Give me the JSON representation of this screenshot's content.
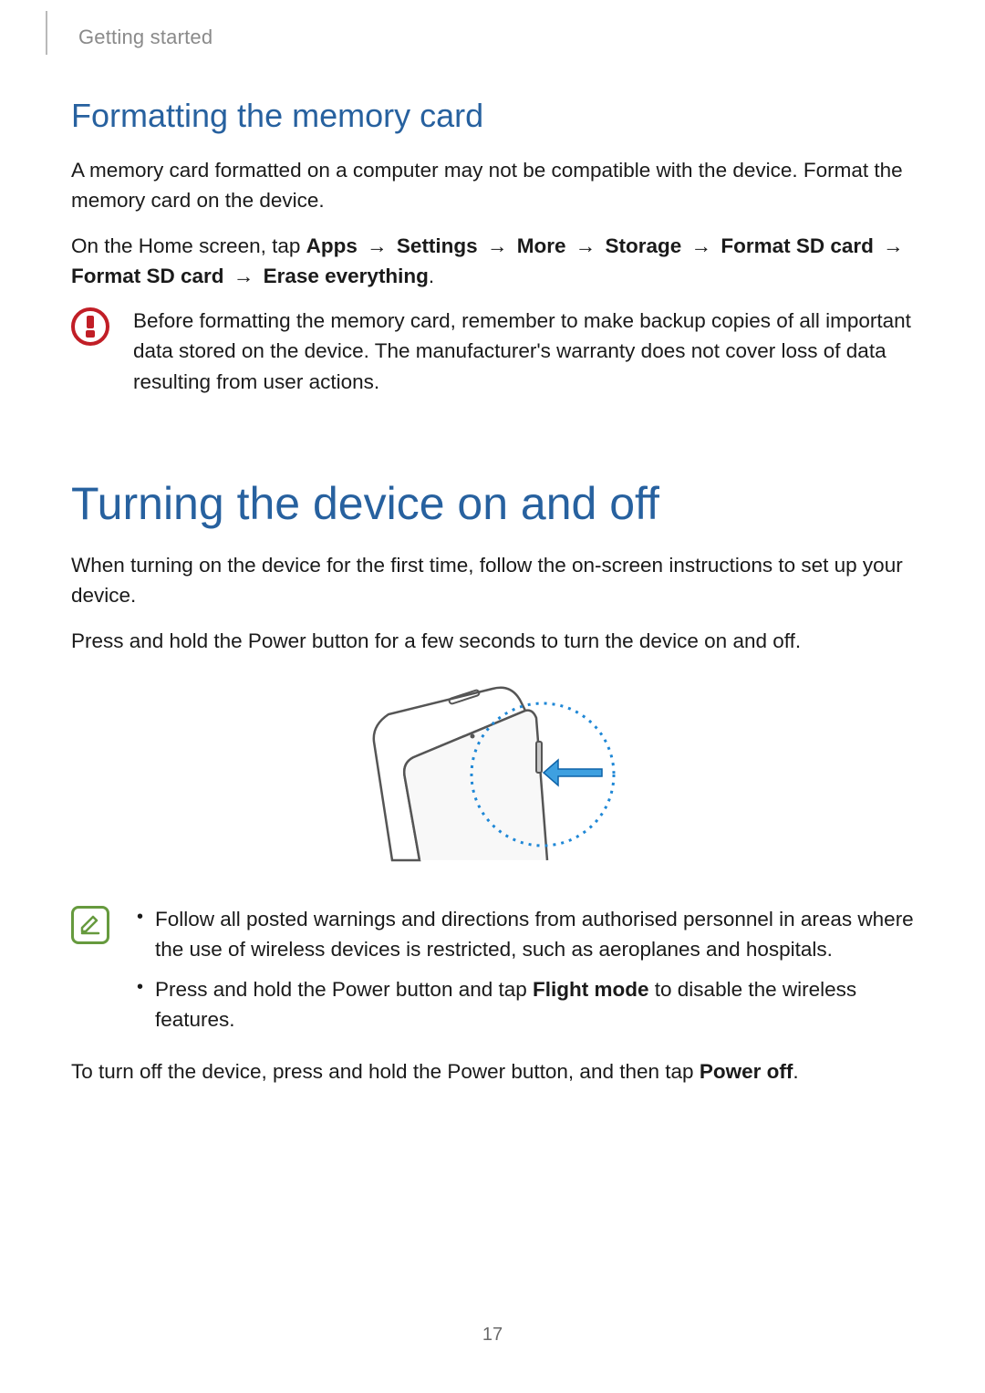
{
  "header": {
    "section": "Getting started"
  },
  "section1": {
    "heading": "Formatting the memory card",
    "p1": "A memory card formatted on a computer may not be compatible with the device. Format the memory card on the device.",
    "nav_intro": "On the Home screen, tap ",
    "nav": {
      "s1": "Apps",
      "s2": "Settings",
      "s3": "More",
      "s4": "Storage",
      "s5": "Format SD card",
      "s6": "Format SD card",
      "s7": "Erase everything"
    },
    "warning": "Before formatting the memory card, remember to make backup copies of all important data stored on the device. The manufacturer's warranty does not cover loss of data resulting from user actions."
  },
  "section2": {
    "heading": "Turning the device on and off",
    "p1": "When turning on the device for the first time, follow the on-screen instructions to set up your device.",
    "p2": "Press and hold the Power button for a few seconds to turn the device on and off.",
    "note_items": [
      "Follow all posted warnings and directions from authorised personnel in areas where the use of wireless devices is restricted, such as aeroplanes and hospitals."
    ],
    "note_item2_pre": "Press and hold the Power button and tap ",
    "note_item2_bold": "Flight mode",
    "note_item2_post": " to disable the wireless features.",
    "p_off_pre": "To turn off the device, press and hold the Power button, and then tap ",
    "p_off_bold": "Power off",
    "p_off_post": "."
  },
  "arrow": "→",
  "page_number": "17"
}
